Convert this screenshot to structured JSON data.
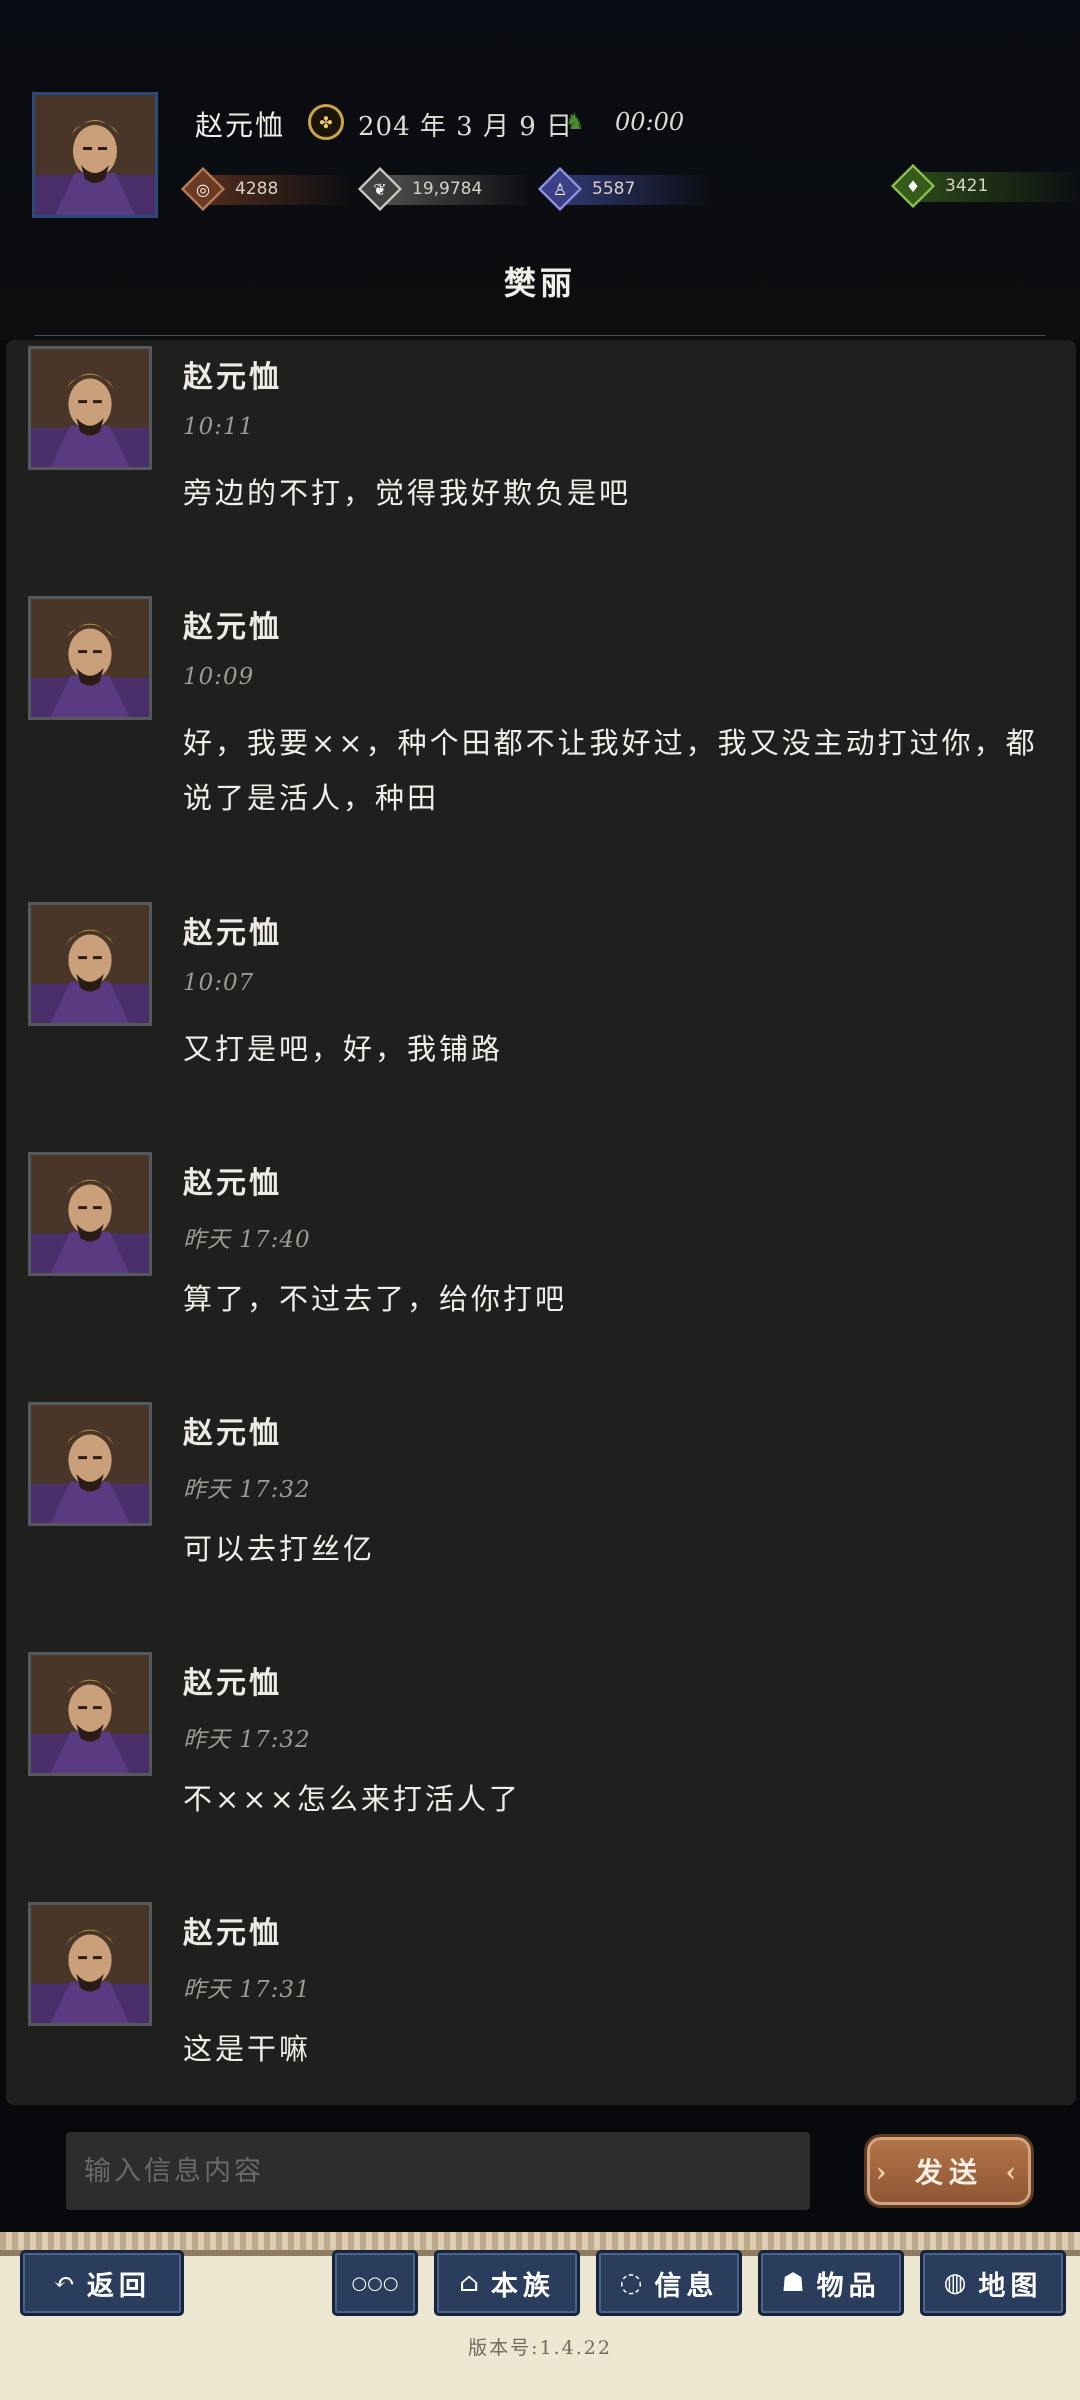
{
  "header": {
    "player_name": "赵元恤",
    "date": "204 年 3 月 9 日",
    "time": "00:00",
    "resources": {
      "copper": "4288",
      "grain": "19,9784",
      "troops": "5587",
      "money": "3421"
    },
    "chat_title": "樊丽"
  },
  "messages": [
    {
      "name": "赵元恤",
      "time": "10:11",
      "text": "旁边的不打，觉得我好欺负是吧"
    },
    {
      "name": "赵元恤",
      "time": "10:09",
      "text": "好，我要××，种个田都不让我好过，我又没主动打过你，都说了是活人，种田"
    },
    {
      "name": "赵元恤",
      "time": "10:07",
      "text": "又打是吧，好，我铺路"
    },
    {
      "name": "赵元恤",
      "time": "昨天 17:40",
      "text": "算了，不过去了，给你打吧"
    },
    {
      "name": "赵元恤",
      "time": "昨天 17:32",
      "text": "可以去打丝亿"
    },
    {
      "name": "赵元恤",
      "time": "昨天 17:32",
      "text": "不×××怎么来打活人了"
    },
    {
      "name": "赵元恤",
      "time": "昨天 17:31",
      "text": "这是干嘛"
    }
  ],
  "composer": {
    "placeholder": "输入信息内容",
    "send_label": "发送"
  },
  "nav": {
    "back": "返回",
    "more": "○○○",
    "clan": "本族",
    "info": "信息",
    "items": "物品",
    "map": "地图"
  },
  "version": "版本号:1.4.22",
  "colors": {
    "background": "#07090c",
    "chat_panel": "#1f1f1d",
    "send_button": "#a46a40",
    "nav_button": "#2a3d5c",
    "bottom_bar": "#ede7d1"
  },
  "icons": {
    "date": "seal-icon",
    "time": "horse-icon",
    "copper": "coin-icon",
    "grain": "grain-icon",
    "troops": "soldier-icon",
    "money": "money-bag-icon"
  }
}
